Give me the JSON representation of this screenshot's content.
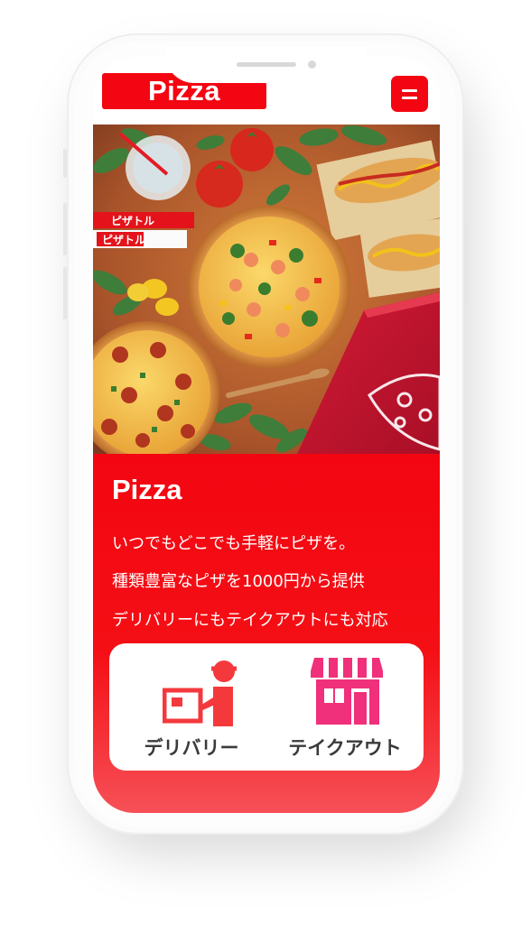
{
  "header": {
    "logo_text": "Pizza",
    "menu_icon": "hamburger-menu-icon"
  },
  "hero": {
    "sign_line_1": "ピザトル",
    "sign_line_2": "ピザトル"
  },
  "intro": {
    "title": "Pizza",
    "lines": [
      "いつでもどこでも手軽にピザを。",
      "種類豊富なピザを1000円から提供",
      "デリバリーにもテイクアウトにも対応"
    ]
  },
  "services": [
    {
      "label": "デリバリー",
      "icon": "delivery-person-icon"
    },
    {
      "label": "テイクアウト",
      "icon": "storefront-icon"
    }
  ],
  "colors": {
    "brand_red": "#f30611",
    "icon_red": "#f4393d",
    "icon_pink": "#f0307a",
    "label_gray": "#3a3a3a"
  }
}
